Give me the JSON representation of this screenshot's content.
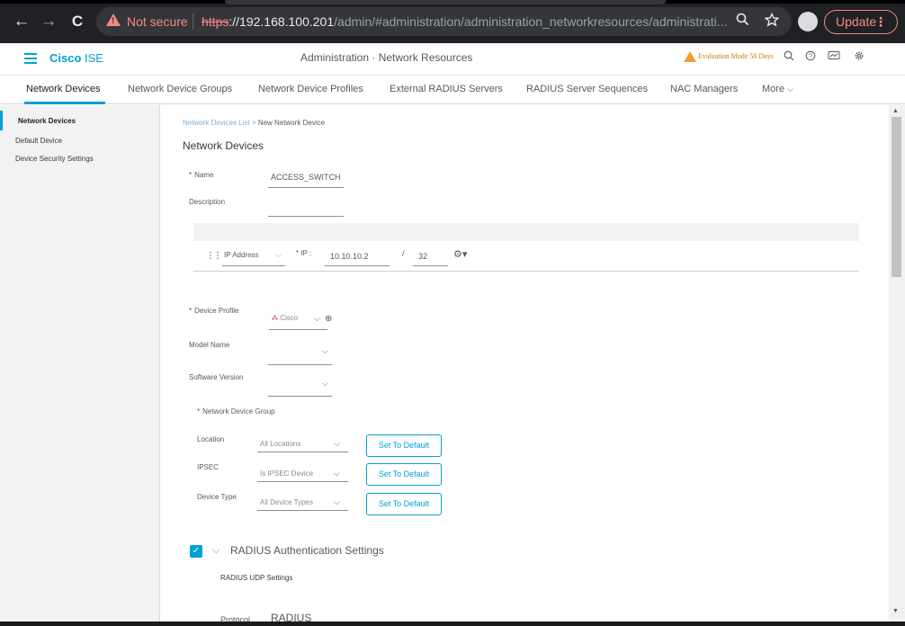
{
  "browser": {
    "back": "←",
    "forward": "→",
    "reload": "C",
    "security_label": "Not secure",
    "url_scheme": "https",
    "url_host": "://192.168.100.201",
    "url_path": "/admin/#administration/administration_networkresources/administrati...",
    "zoom_icon": "magnifier-icon",
    "star_icon": "star-icon",
    "update_label": "Update",
    "menu_dots": "⋮"
  },
  "header": {
    "brand_bold": "Cisco",
    "brand_rest": " ISE",
    "page_title": "Administration · Network Resources",
    "eval_text": "Evaluation Mode 50 Days"
  },
  "tabs": [
    {
      "label": "Network Devices"
    },
    {
      "label": "Network Device Groups"
    },
    {
      "label": "Network Device Profiles"
    },
    {
      "label": "External RADIUS Servers"
    },
    {
      "label": "RADIUS Server Sequences"
    },
    {
      "label": "NAC Managers"
    },
    {
      "label": "More"
    }
  ],
  "sidebar": {
    "items": [
      {
        "label": "Network Devices"
      },
      {
        "label": "Default Device"
      },
      {
        "label": "Device Security Settings"
      }
    ]
  },
  "breadcrumb": {
    "parent": "Network Devices List",
    "separator": ">",
    "current": "New Network Device"
  },
  "form": {
    "section_title": "Network Devices",
    "name_label": "Name",
    "name_value": "ACCESS_SWITCH",
    "description_label": "Description",
    "description_value": "",
    "ip_type": "IP Address",
    "ip_label": "* IP :",
    "ip_value": "10.10.10.2",
    "mask_sep": "/",
    "mask_value": "32",
    "device_profile_label": "Device Profile",
    "device_profile_value": "Cisco",
    "model_name_label": "Model Name",
    "software_version_label": "Software Version",
    "ndg_label": "Network Device Group",
    "location_label": "Location",
    "location_value": "All Locations",
    "ipsec_label": "IPSEC",
    "ipsec_value": "Is IPSEC Device",
    "device_type_label": "Device Type",
    "device_type_value": "All Device Types",
    "set_default_label": "Set To Default",
    "radius_title": "RADIUS Authentication Settings",
    "radius_udp_title": "RADIUS UDP Settings",
    "protocol_label": "Protocol",
    "protocol_value": "RADIUS"
  }
}
